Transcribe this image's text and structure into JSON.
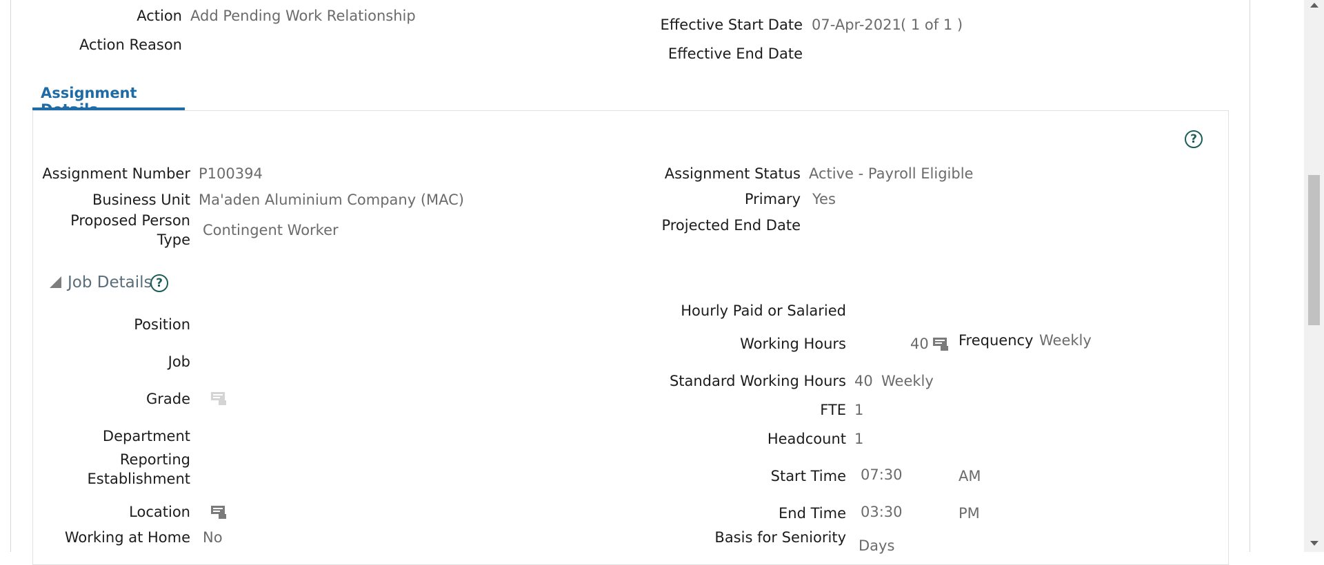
{
  "header": {
    "action_label": "Action",
    "action_value": "Add Pending Work Relationship",
    "action_reason_label": "Action Reason",
    "effective_start_label": "Effective Start Date",
    "effective_start_value": "07-Apr-2021",
    "record_counter": "(  1 of 1  )",
    "effective_end_label": "Effective End Date"
  },
  "tabs": [
    {
      "label": "Assignment Details",
      "selected": true
    }
  ],
  "assignment": {
    "number_label": "Assignment Number",
    "number_value": "P100394",
    "business_unit_label": "Business Unit",
    "business_unit_value": "Ma'aden Aluminium Company (MAC)",
    "person_type_label_line1": "Proposed Person",
    "person_type_label_line2": "Type",
    "person_type_value": "Contingent Worker",
    "status_label": "Assignment Status",
    "status_value": "Active - Payroll Eligible",
    "primary_label": "Primary",
    "primary_value": "Yes",
    "projected_end_label": "Projected End Date"
  },
  "job_details": {
    "section_title": "Job Details",
    "position_label": "Position",
    "job_label": "Job",
    "grade_label": "Grade",
    "department_label": "Department",
    "reporting_label_line1": "Reporting",
    "reporting_label_line2": "Establishment",
    "location_label": "Location",
    "working_at_home_label": "Working at Home",
    "working_at_home_value": "No",
    "hourly_salaried_label": "Hourly Paid or Salaried",
    "working_hours_label": "Working Hours",
    "working_hours_value": "40",
    "frequency_label": "Frequency",
    "frequency_value": "Weekly",
    "standard_hours_label": "Standard Working Hours",
    "standard_hours_value": "40",
    "standard_hours_unit": "Weekly",
    "fte_label": "FTE",
    "fte_value": "1",
    "headcount_label": "Headcount",
    "headcount_value": "1",
    "start_time_label": "Start Time",
    "start_time_value": "07:30",
    "start_time_ampm": "AM",
    "end_time_label": "End Time",
    "end_time_value": "03:30",
    "end_time_ampm": "PM",
    "seniority_label": "Basis for Seniority",
    "seniority_value": "Days"
  },
  "icons": {
    "help": "help-circle-icon",
    "list": "list-details-icon",
    "collapse": "collapse-triangle-icon"
  },
  "colors": {
    "tab_accent": "#1f6ba5",
    "help_icon": "#1c5e57",
    "value_text": "#6b6b6b"
  }
}
